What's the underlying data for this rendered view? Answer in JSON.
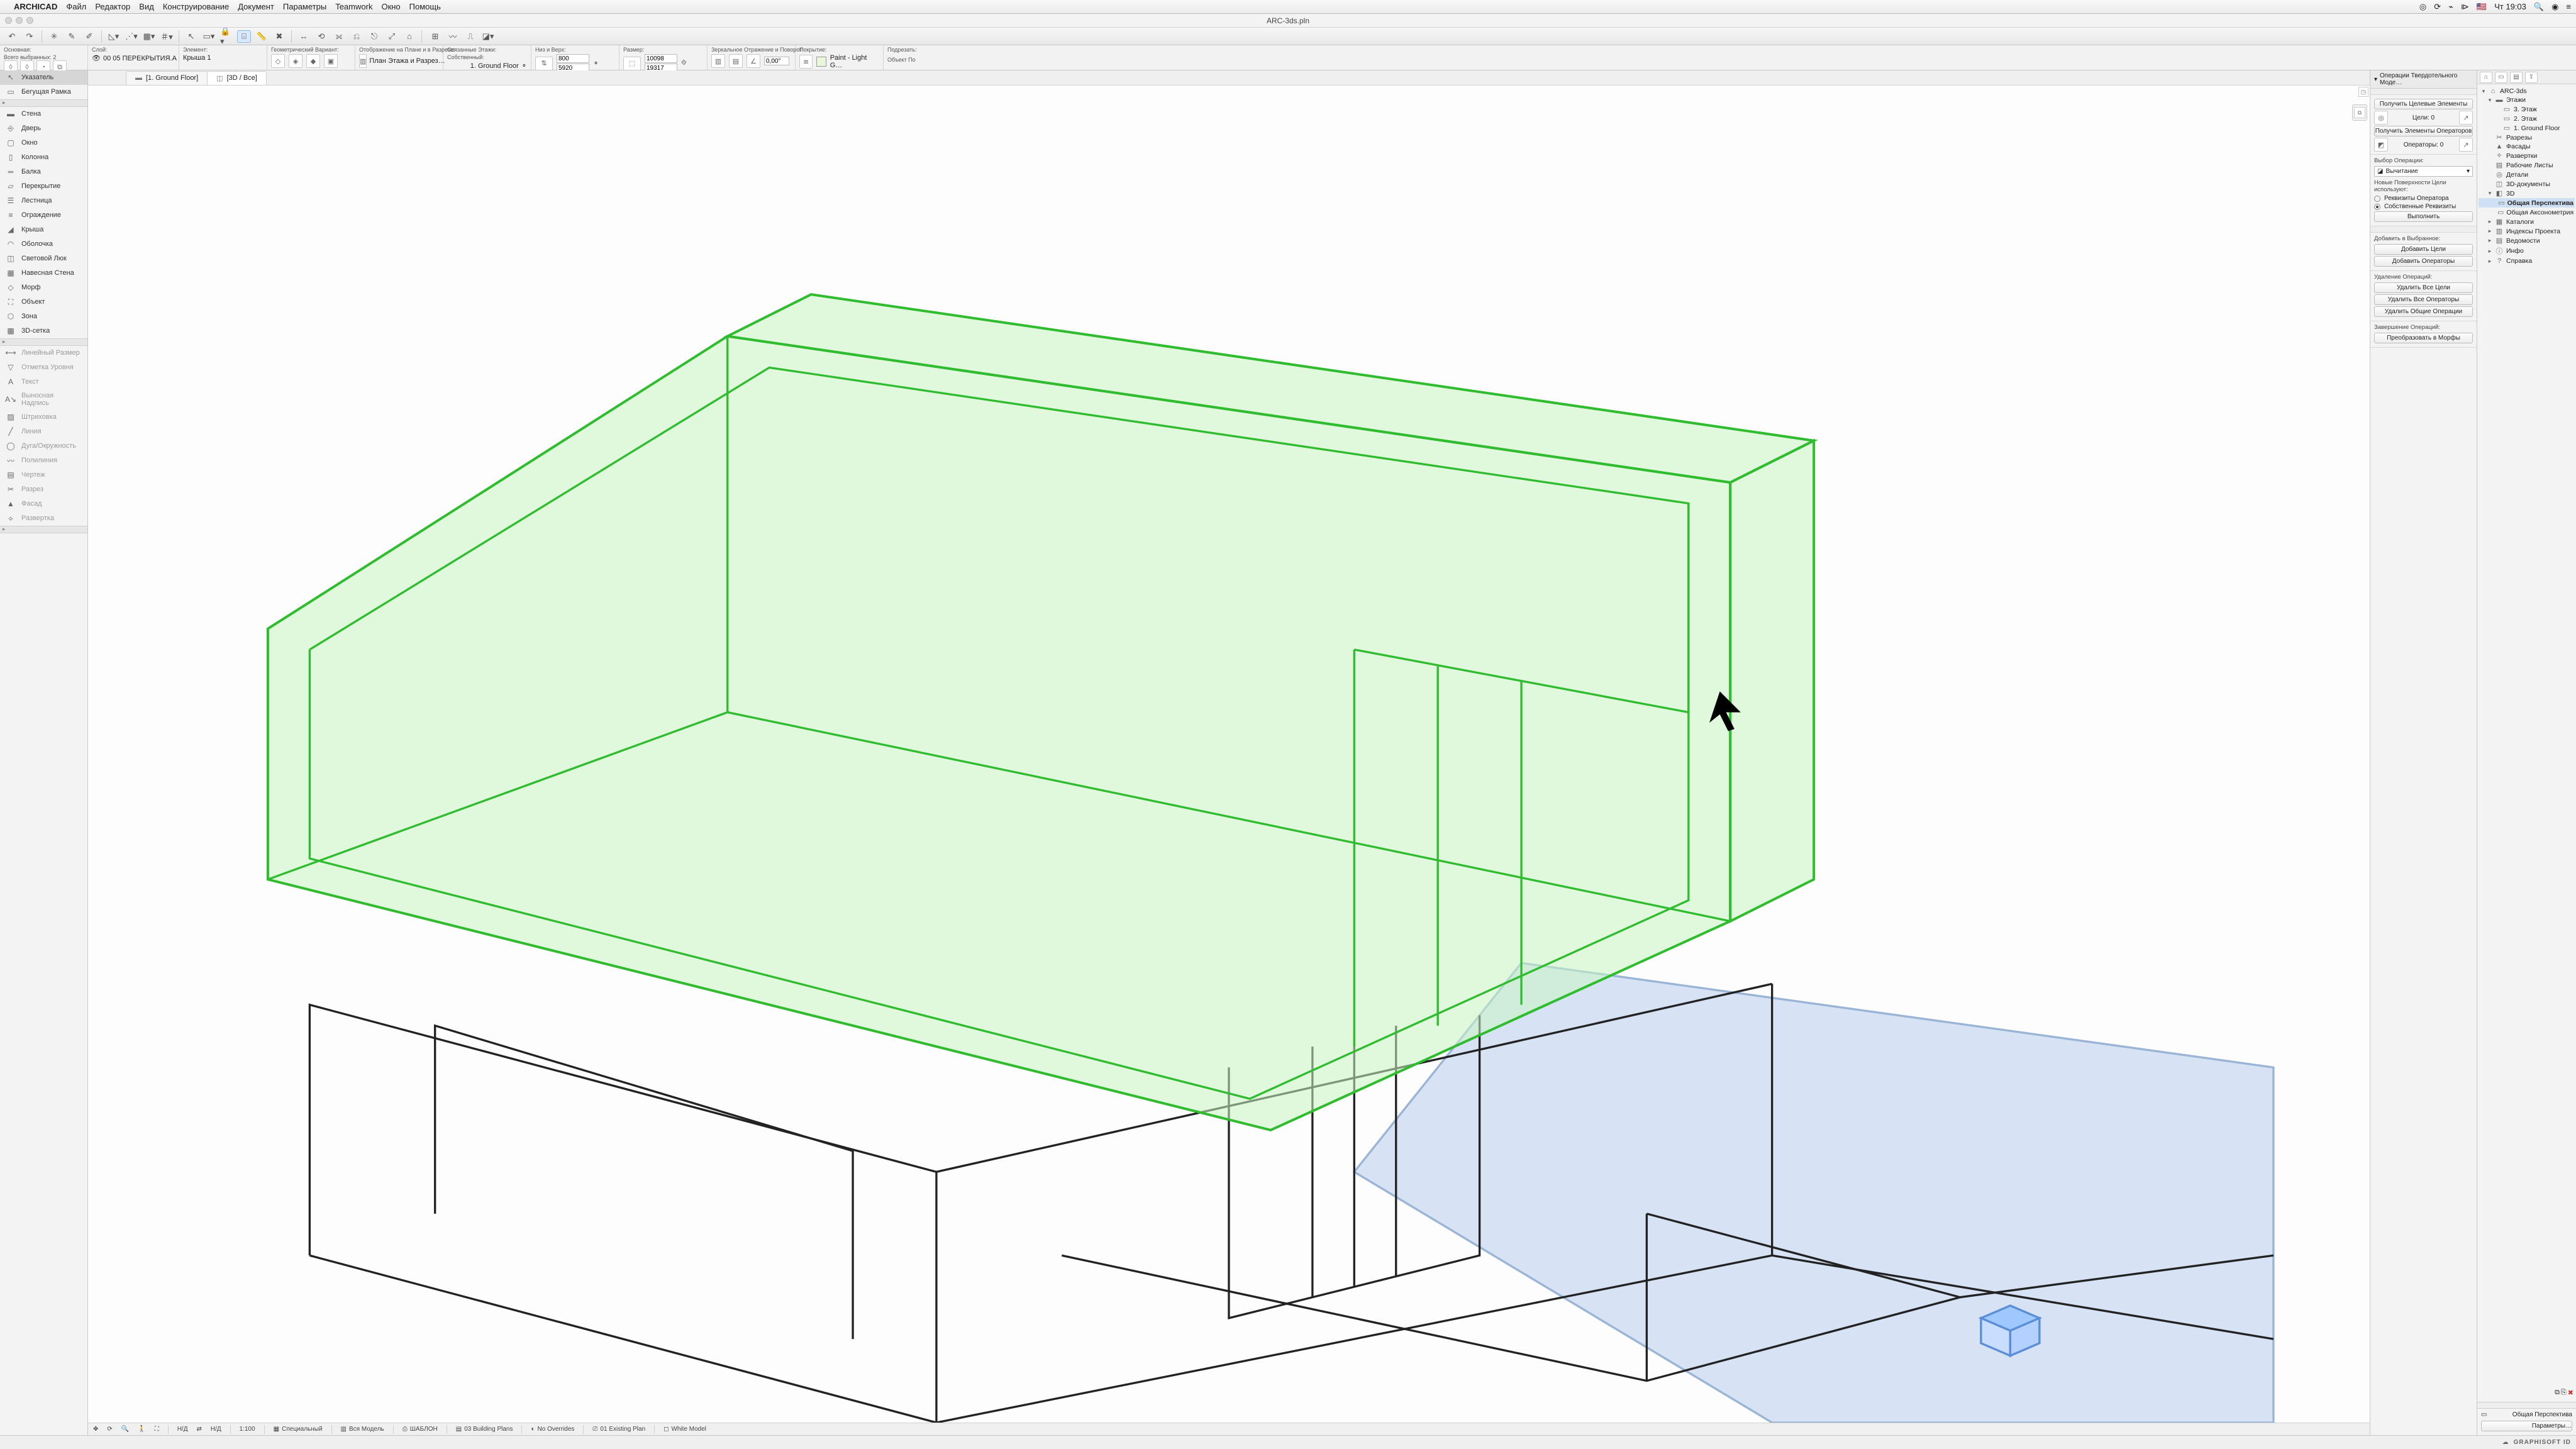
{
  "menubar": {
    "app": "ARCHICAD",
    "items": [
      "Файл",
      "Редактор",
      "Вид",
      "Конструирование",
      "Документ",
      "Параметры",
      "Teamwork",
      "Окно",
      "Помощь"
    ],
    "clock": "Чт 19:03"
  },
  "document_title": "ARC-3ds.pln",
  "infobar": {
    "selection_label": "Основная:",
    "selection_count_label": "Всего выбранных: 2",
    "layer_label": "Слой:",
    "layer_value": "00 05 ПЕРЕКРЫТИЯ.А",
    "element_label": "Элемент:",
    "element_value": "Крыша 1",
    "geom_label": "Геометрический Вариант:",
    "display_label": "Отображение на Плане и в Разрезе:",
    "display_value": "План Этажа и Разрез…",
    "linked_label": "Связанные Этажи:",
    "own_label": "Собственный:",
    "own_value": "1. Ground Floor",
    "bottomtop_label": "Низ и Верх:",
    "bt_top": "800",
    "bt_bottom": "5920",
    "size_label": "Размер:",
    "size_w": "10098",
    "size_h": "19317",
    "mirror_label": "Зеркальное Отражение и Поворот:",
    "angle": "0,00°",
    "surface_label": "Покрытие:",
    "surface_value": "Paint - Light G…",
    "adjust_label": "Подрезать:",
    "object_params": "Объект По"
  },
  "view_tabs": {
    "t1": "[1. Ground Floor]",
    "t2": "[3D / Все]"
  },
  "toolbox": {
    "arrow": "Указатель",
    "marquee": "Бегущая Рамка",
    "wall": "Стена",
    "door": "Дверь",
    "window": "Окно",
    "column": "Колонна",
    "beam": "Балка",
    "slab": "Перекрытие",
    "stair": "Лестница",
    "railing": "Ограждение",
    "roof": "Крыша",
    "shell": "Оболочка",
    "skylight": "Световой Люк",
    "curtain": "Навесная Стена",
    "morph": "Морф",
    "object": "Объект",
    "zone": "Зона",
    "mesh": "3D-сетка",
    "dim_lin": "Линейный Размер",
    "dim_lvl": "Отметка Уровня",
    "text": "Текст",
    "label": "Выносная Надпись",
    "fill": "Штриховка",
    "line": "Линия",
    "arc": "Дуга/Окружность",
    "poly": "Полилиния",
    "draw": "Чертеж",
    "section": "Разрез",
    "elev": "Фасад",
    "interior": "Развертка"
  },
  "solid_ops": {
    "title": "Операции Твердотельного Моде…",
    "get_targets": "Получить Целевые Элементы",
    "targets_label": "Цели: 0",
    "get_operators": "Получить Элементы Операторов",
    "operators_label": "Операторы: 0",
    "choose_op": "Выбор Операции:",
    "op_value": "Вычитание",
    "new_surfaces": "Новые Поверхности Цели используют:",
    "opt1": "Реквизиты Оператора",
    "opt2": "Собственные Реквизиты",
    "execute": "Выполнить",
    "add_to_sel": "Добавить в Выбранное:",
    "add_targets": "Добавить Цели",
    "add_operators": "Добавить Операторы",
    "del_ops": "Удаление Операций:",
    "del_all_t": "Удалить Все Цели",
    "del_all_o": "Удалить Все Операторы",
    "del_common": "Удалить Общие Операции",
    "finish": "Завершение Операций:",
    "morph": "Преобразовать в Морфы"
  },
  "navigator": {
    "root": "ARC-3ds",
    "stories": "Этажи",
    "s3": "3. Этаж",
    "s2": "2. Этаж",
    "s1": "1. Ground Floor",
    "sections": "Разрезы",
    "elevations": "Фасады",
    "interiors": "Развертки",
    "worksheets": "Рабочие Листы",
    "details": "Детали",
    "docs3d": "3D-документы",
    "n3d": "3D",
    "persp": "Общая Перспектива",
    "axo": "Общая Аксонометрия",
    "catalogs": "Каталоги",
    "indexes": "Индексы Проекта",
    "schedules": "Ведомости",
    "info": "Инфо",
    "help": "Справка",
    "footer_view": "Общая Перспектива",
    "footer_params": "Параметры…"
  },
  "bottombar": {
    "na1": "Н/Д",
    "na2": "Н/Д",
    "scale": "1:100",
    "special": "Специальный",
    "allmodel": "Вся Модель",
    "template": "ШАБЛОН",
    "plans": "03 Building Plans",
    "overrides": "No Overrides",
    "exist": "01 Existing Plan",
    "white": "White Model"
  },
  "statusbar": {
    "brand": "GRAPHISOFT ID"
  }
}
